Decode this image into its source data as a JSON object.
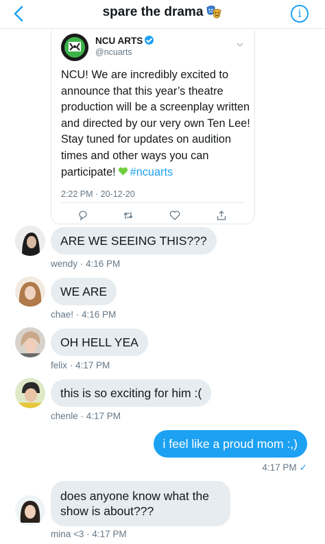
{
  "header": {
    "title": "spare the drama",
    "back_icon": "chevron-left-icon",
    "info_label": "i",
    "emoji": "performing-arts-masks-icon",
    "accent_color": "#1da1f2"
  },
  "tweet": {
    "display_name": "NCU ARTS",
    "handle": "@ncuarts",
    "text": "NCU! We are incredibly excited to announce that this year’s theatre production will be a screenplay written and directed by our very own Ten Lee! Stay tuned for updates on audition times and other ways you can participate!",
    "hashtag": "#ncuarts",
    "timestamp": "2:22 PM · 20-12-20",
    "icons": [
      "reply-icon",
      "retweet-icon",
      "like-icon",
      "share-icon"
    ]
  },
  "messages": [
    {
      "text": "ARE WE SEEING THIS???",
      "sender": "wendy",
      "time": "4:16 PM",
      "meta": "wendy · 4:16 PM"
    },
    {
      "text": "WE ARE",
      "sender": "chae!",
      "time": "4:16 PM",
      "meta": "chae! · 4:16 PM"
    },
    {
      "text": "OH HELL YEA",
      "sender": "felix",
      "time": "4:17 PM",
      "meta": "felix · 4:17 PM"
    },
    {
      "text": "this is so exciting for him :(",
      "sender": "chenle",
      "time": "4:17 PM",
      "meta": "chenle · 4:17 PM"
    },
    {
      "text": "does anyone know what the show is about???",
      "sender": "mina <3",
      "time": "4:17 PM",
      "meta": "mina <3 · 4:17 PM"
    }
  ],
  "sent_message": {
    "text": "i feel like a proud mom :,)",
    "time": "4:17 PM",
    "status": "✓"
  }
}
